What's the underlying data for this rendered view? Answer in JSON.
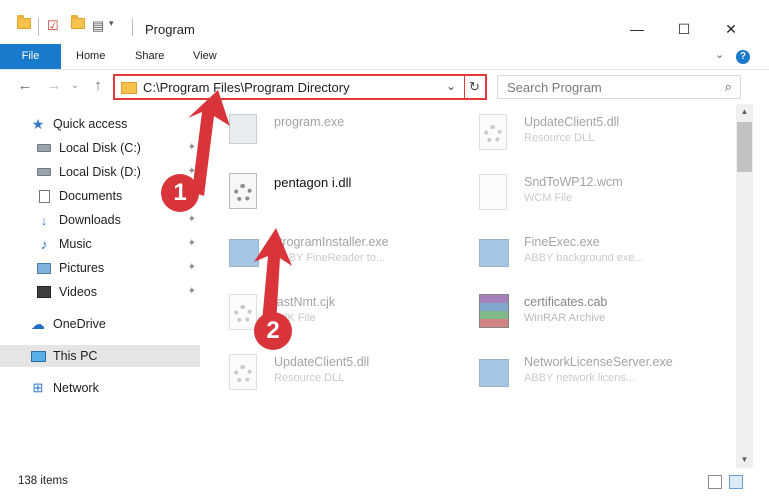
{
  "window": {
    "title": "Program",
    "minimize": "—",
    "maximize": "☐",
    "close": "✕"
  },
  "ribbon": {
    "tabs": [
      "File",
      "Home",
      "Share",
      "View"
    ],
    "expand": "⌄",
    "help": "?"
  },
  "navigation": {
    "back": "←",
    "forward": "→",
    "history": "⌄",
    "up": "↑",
    "address": "C:\\Program Files\\Program Directory",
    "address_dropdown": "⌄",
    "refresh": "↻",
    "search_placeholder": "Search Program",
    "search_icon": "⌕"
  },
  "sidebar": {
    "items": [
      {
        "label": "Quick access",
        "icon": "star-icon"
      },
      {
        "label": "Local Disk (C:)",
        "icon": "disk-icon",
        "pinned": true
      },
      {
        "label": "Local Disk (D:)",
        "icon": "disk-icon",
        "pinned": true
      },
      {
        "label": "Documents",
        "icon": "document-icon",
        "pinned": true
      },
      {
        "label": "Downloads",
        "icon": "download-icon",
        "pinned": true
      },
      {
        "label": "Music",
        "icon": "music-icon",
        "pinned": true
      },
      {
        "label": "Pictures",
        "icon": "pictures-icon",
        "pinned": true
      },
      {
        "label": "Videos",
        "icon": "video-icon",
        "pinned": true
      },
      {
        "label": "OneDrive",
        "icon": "cloud-icon"
      },
      {
        "label": "This PC",
        "icon": "computer-icon",
        "selected": true
      },
      {
        "label": "Network",
        "icon": "network-icon"
      }
    ],
    "pin_glyph": "📌"
  },
  "files": [
    {
      "name": "program.exe",
      "type": "",
      "icon": "setup-icon"
    },
    {
      "name": "UpdateClient5.dll",
      "type": "Resource DLL",
      "icon": "dll-icon"
    },
    {
      "name": "pentagon i.dll",
      "type": "",
      "icon": "dll-icon",
      "highlighted": true
    },
    {
      "name": "SndToWP12.wcm",
      "type": "WCM File",
      "icon": "file-icon"
    },
    {
      "name": "ProgramInstaller.exe",
      "type": "ABBY FineReader to...",
      "icon": "app-icon"
    },
    {
      "name": "FineExec.exe",
      "type": "ABBY background exe...",
      "icon": "app-icon"
    },
    {
      "name": "lastNmt.cjk",
      "type": "CJK File",
      "icon": "dll-icon"
    },
    {
      "name": "certificates.cab",
      "type": "WinRAR Archive",
      "icon": "archive-icon"
    },
    {
      "name": "UpdateClient5.dll",
      "type": "Resource DLL",
      "icon": "dll-icon"
    },
    {
      "name": "NetworkLicenseServer.exe",
      "type": "ABBY network licens...",
      "icon": "app-icon"
    }
  ],
  "status": {
    "item_count": "138 items"
  },
  "callouts": [
    "1",
    "2"
  ],
  "colors": {
    "accent": "#1979ca",
    "highlight_border": "#e03a3a",
    "callout": "#d8343a"
  }
}
